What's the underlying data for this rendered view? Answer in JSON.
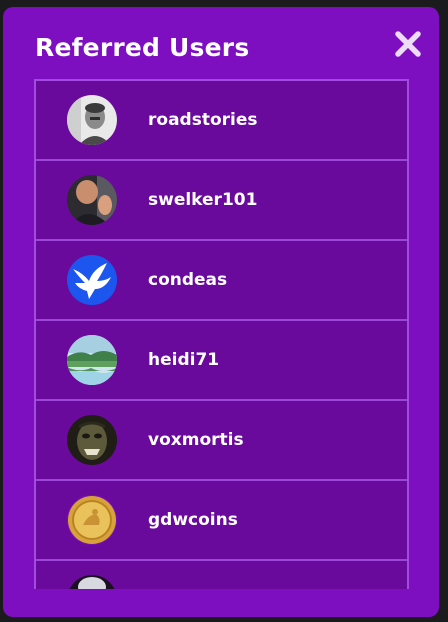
{
  "modal": {
    "title": "Referred Users",
    "close_icon": "close-icon"
  },
  "colors": {
    "modal_bg": "#7d0fc0",
    "list_bg": "#6a0a9c",
    "divider": "#9a47d8",
    "text": "#ffffff"
  },
  "users": [
    {
      "username": "roadstories",
      "avatar": "avatar-portrait-bw"
    },
    {
      "username": "swelker101",
      "avatar": "avatar-portrait-selfie"
    },
    {
      "username": "condeas",
      "avatar": "avatar-white-dove-blue"
    },
    {
      "username": "heidi71",
      "avatar": "avatar-lake-landscape"
    },
    {
      "username": "voxmortis",
      "avatar": "avatar-goblin-mask"
    },
    {
      "username": "gdwcoins",
      "avatar": "avatar-gold-coin"
    },
    {
      "username": "",
      "avatar": "avatar-partial"
    }
  ]
}
